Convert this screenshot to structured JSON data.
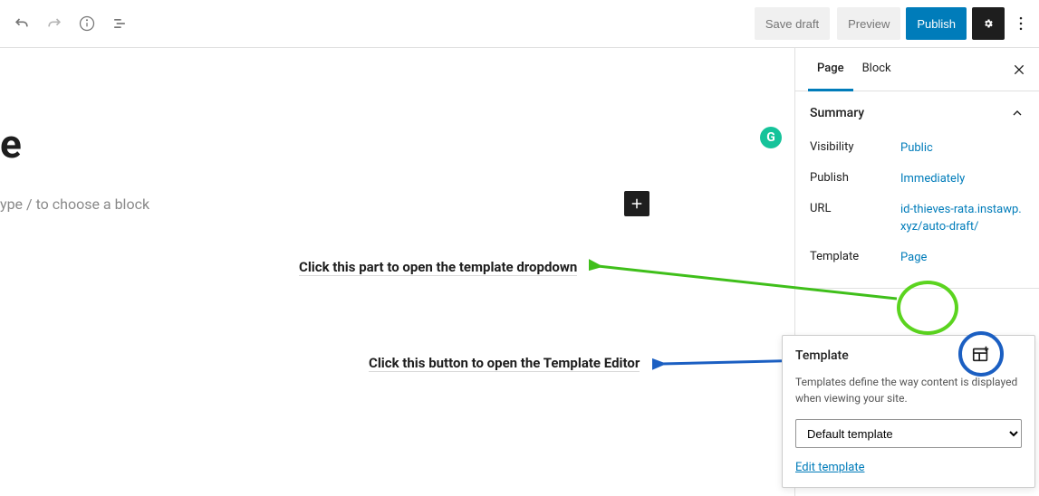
{
  "toolbar": {
    "save_draft": "Save draft",
    "preview": "Preview",
    "publish": "Publish"
  },
  "canvas": {
    "title_fragment": "e",
    "placeholder": "ype / to choose a block"
  },
  "sidebar": {
    "tabs": {
      "page": "Page",
      "block": "Block"
    },
    "summary": {
      "title": "Summary",
      "rows": {
        "visibility_label": "Visibility",
        "visibility_value": "Public",
        "publish_label": "Publish",
        "publish_value": "Immediately",
        "url_label": "URL",
        "url_value": "id-thieves-rata.instawp.xyz/auto-draft/",
        "template_label": "Template",
        "template_value": "Page"
      }
    }
  },
  "popover": {
    "title": "Template",
    "description": "Templates define the way content is displayed when viewing your site.",
    "select_value": "Default template",
    "edit_link": "Edit template"
  },
  "annotations": {
    "dropdown": "Click this part to open the template dropdown",
    "editor": "Click this button to open the Template Editor"
  }
}
